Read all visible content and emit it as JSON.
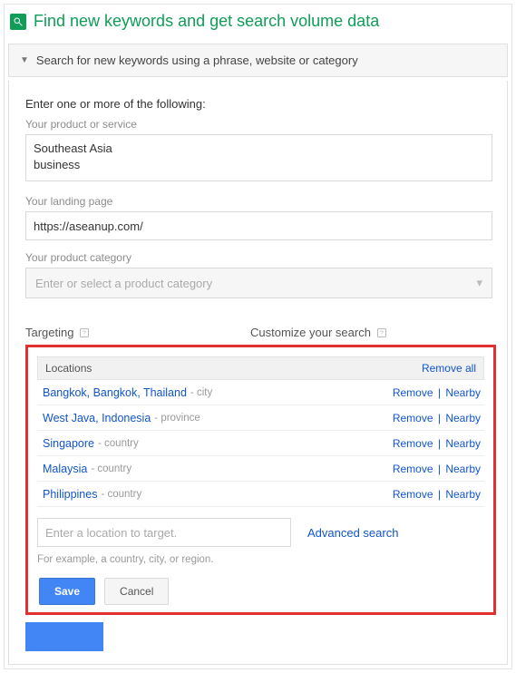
{
  "page_title": "Find new keywords and get search volume data",
  "accordion_label": "Search for new keywords using a phrase, website or category",
  "form": {
    "heading": "Enter one or more of the following:",
    "product_label": "Your product or service",
    "product_value": "Southeast Asia\nbusiness",
    "landing_label": "Your landing page",
    "landing_value": "https://aseanup.com/",
    "category_label": "Your product category",
    "category_placeholder": "Enter or select a product category"
  },
  "sections": {
    "targeting": "Targeting",
    "customize": "Customize your search"
  },
  "targeting": {
    "locations_label": "Locations",
    "remove_all": "Remove all",
    "rows": [
      {
        "name": "Bangkok, Bangkok, Thailand",
        "type": "city"
      },
      {
        "name": "West Java, Indonesia",
        "type": "province"
      },
      {
        "name": "Singapore",
        "type": "country"
      },
      {
        "name": "Malaysia",
        "type": "country"
      },
      {
        "name": "Philippines",
        "type": "country"
      }
    ],
    "row_actions": {
      "remove": "Remove",
      "nearby": "Nearby"
    },
    "location_placeholder": "Enter a location to target.",
    "advanced": "Advanced search",
    "hint": "For example, a country, city, or region.",
    "save": "Save",
    "cancel": "Cancel"
  }
}
